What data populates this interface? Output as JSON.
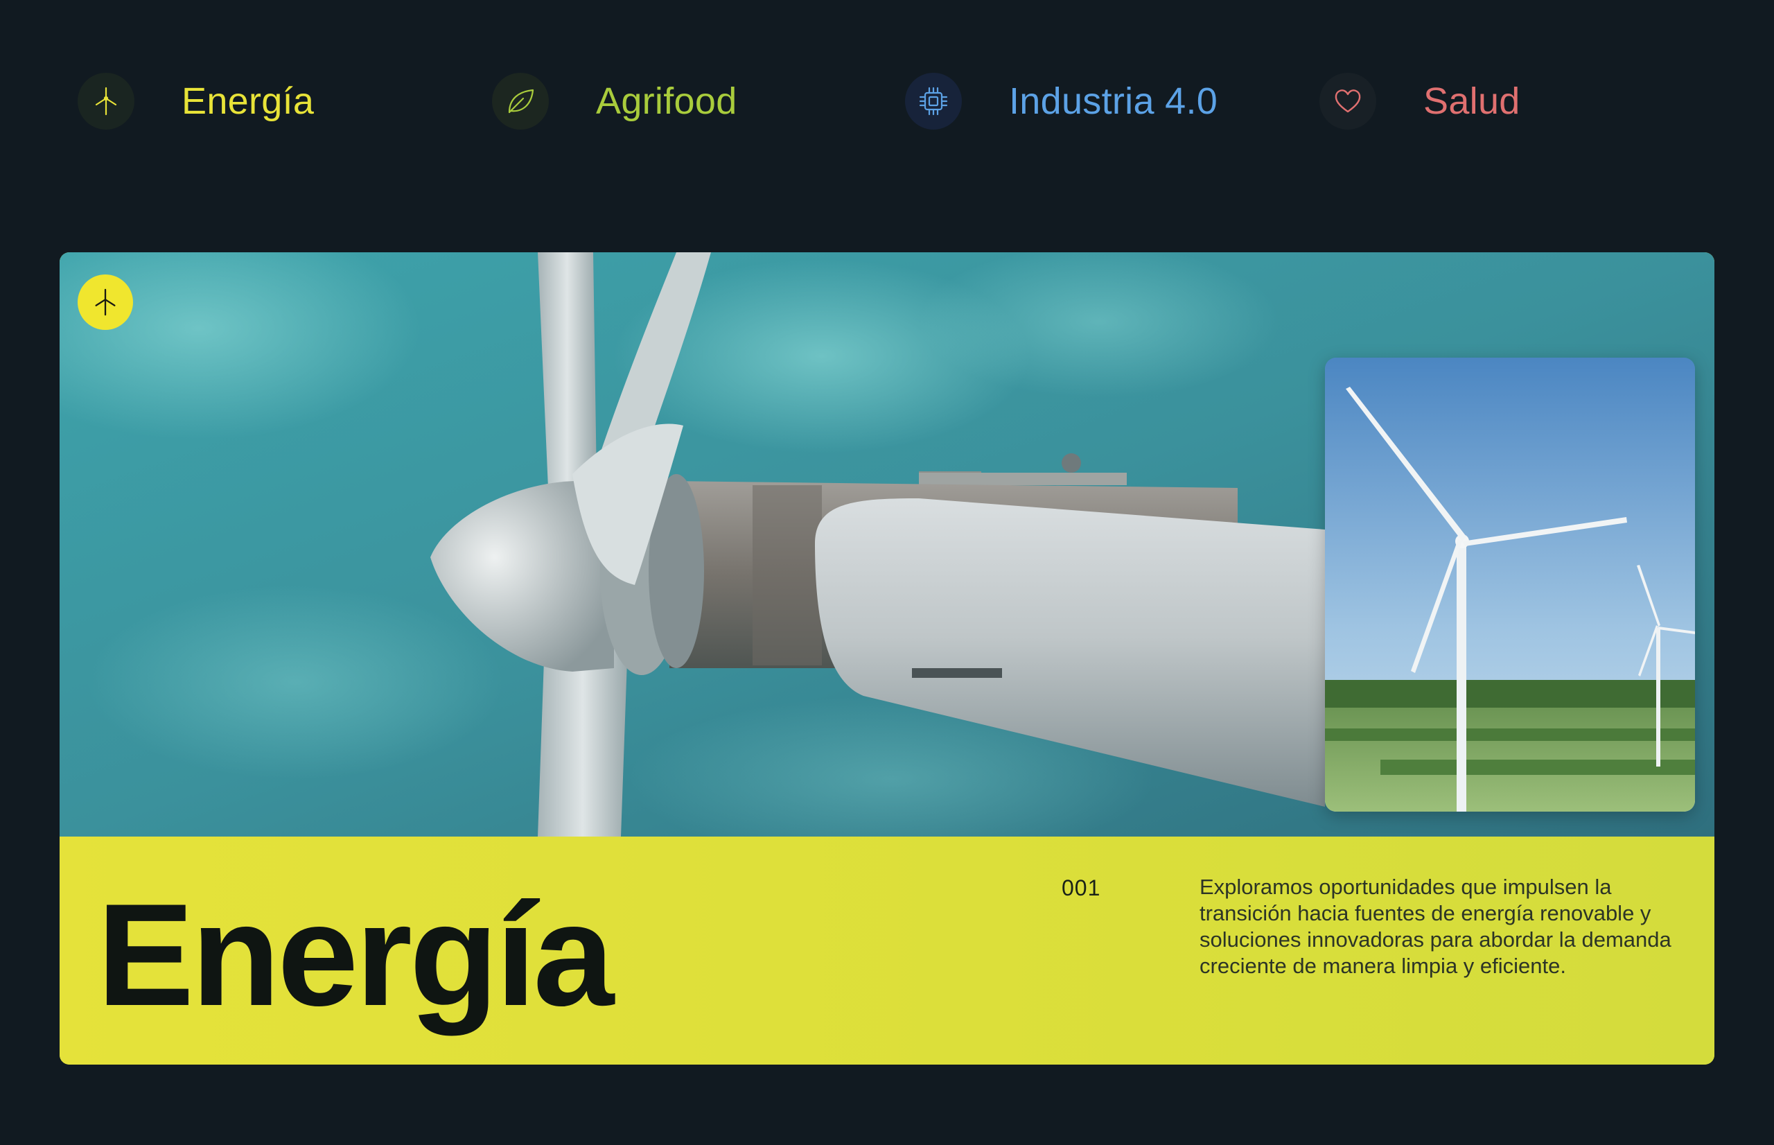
{
  "tabs": [
    {
      "label": "Energía",
      "icon": "wind-turbine-icon",
      "color": "#e8e338"
    },
    {
      "label": "Agrifood",
      "icon": "leaf-icon",
      "color": "#a9cc3c"
    },
    {
      "label": "Industria 4.0",
      "icon": "chip-icon",
      "color": "#5ca2e6"
    },
    {
      "label": "Salud",
      "icon": "heart-icon",
      "color": "#e07070"
    }
  ],
  "card": {
    "badge_icon": "wind-turbine-icon",
    "title": "Energía",
    "number": "001",
    "description": "Exploramos oportunidades que impulsen la transición hacia fuentes de energía renovable y soluciones innovadoras para abordar la demanda creciente de manera limpia y eficiente.",
    "accent": "#dde03a",
    "hero_image": "wind-turbine-closeup-photo",
    "inset_image": "wind-turbines-field-photo"
  }
}
